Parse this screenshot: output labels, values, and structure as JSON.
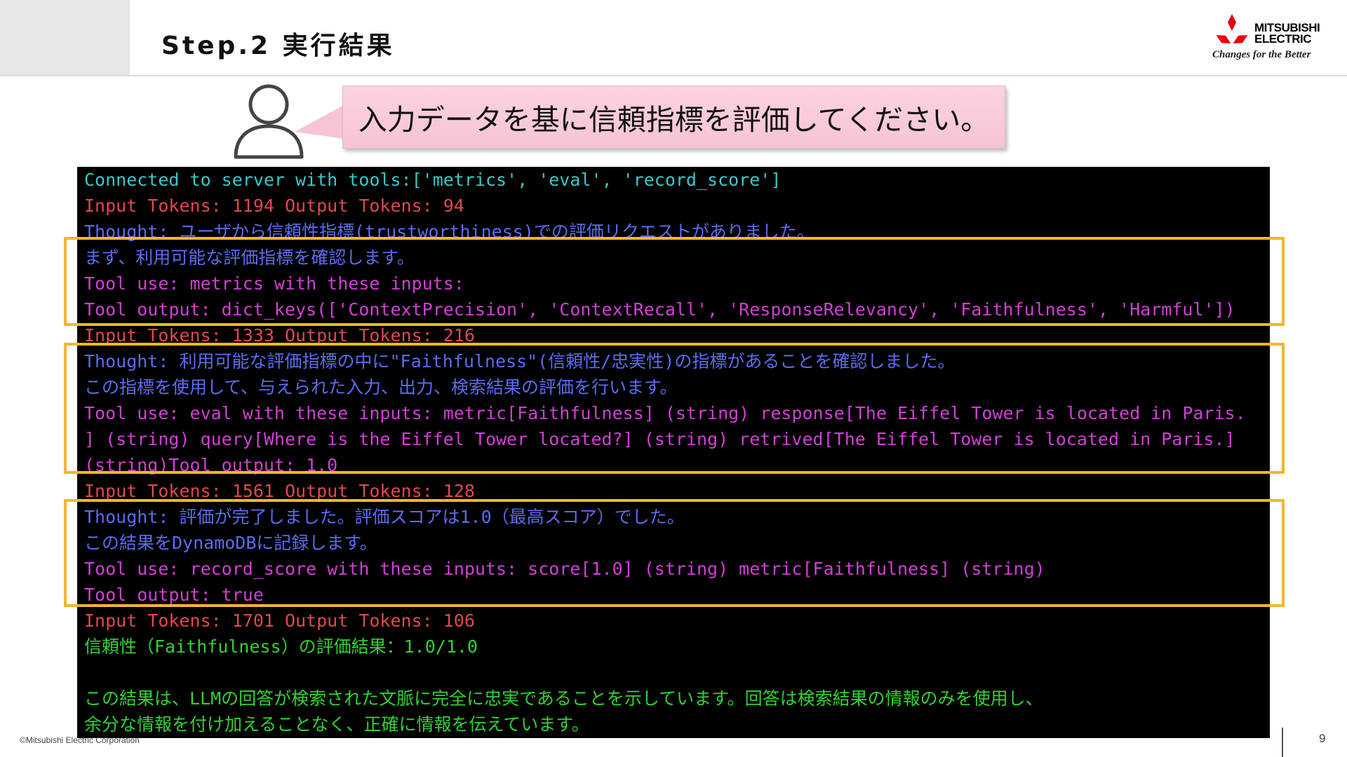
{
  "header": {
    "title": "Step.2 実行結果"
  },
  "logo": {
    "line1": "MITSUBISHI",
    "line2": "ELECTRIC",
    "tagline": "Changes for the Better"
  },
  "prompt": {
    "text": "入力データを基に信頼指標を評価してください。"
  },
  "terminal": {
    "lines": [
      {
        "text": "Connected to server with tools:['metrics', 'eval', 'record_score']",
        "color": "#3ac8c8"
      },
      {
        "text": "Input Tokens: 1194 Output Tokens: 94",
        "color": "#e0484e"
      },
      {
        "text": "Thought: ユーザから信頼性指標(trustworthiness)での評価リクエストがありました。",
        "color": "#5b6cf0"
      },
      {
        "text": "まず、利用可能な評価指標を確認します。",
        "color": "#5b6cf0"
      },
      {
        "text": "Tool use: metrics with these inputs:",
        "color": "#d23fd6"
      },
      {
        "text": "Tool output: dict_keys(['ContextPrecision', 'ContextRecall', 'ResponseRelevancy', 'Faithfulness', 'Harmful'])",
        "color": "#d23fd6"
      },
      {
        "text": "Input Tokens: 1333 Output Tokens: 216",
        "color": "#e0484e"
      },
      {
        "text": "Thought: 利用可能な評価指標の中に\"Faithfulness\"(信頼性/忠実性)の指標があることを確認しました。",
        "color": "#5b6cf0"
      },
      {
        "text": "この指標を使用して、与えられた入力、出力、検索結果の評価を行います。",
        "color": "#5b6cf0"
      },
      {
        "text": "Tool use: eval with these inputs: metric[Faithfulness] (string) response[The Eiffel Tower is located in Paris.",
        "color": "#d23fd6"
      },
      {
        "text": "] (string) query[Where is the Eiffel Tower located?] (string) retrived[The Eiffel Tower is located in Paris.]",
        "color": "#d23fd6"
      },
      {
        "text": "(string)Tool output: 1.0",
        "color": "#d23fd6"
      },
      {
        "text": "Input Tokens: 1561 Output Tokens: 128",
        "color": "#e0484e"
      },
      {
        "text": "Thought: 評価が完了しました。評価スコアは1.0（最高スコア）でした。",
        "color": "#5b6cf0"
      },
      {
        "text": "この結果をDynamoDBに記録します。",
        "color": "#5b6cf0"
      },
      {
        "text": "Tool use: record_score with these inputs: score[1.0] (string) metric[Faithfulness] (string)",
        "color": "#d23fd6"
      },
      {
        "text": "Tool output: true",
        "color": "#d23fd6"
      },
      {
        "text": "Input Tokens: 1701 Output Tokens: 106",
        "color": "#e0484e"
      },
      {
        "text": "信頼性（Faithfulness）の評価結果：1.0/1.0",
        "color": "#31d233"
      },
      {
        "text": "",
        "color": "#31d233"
      },
      {
        "text": "この結果は、LLMの回答が検索された文脈に完全に忠実であることを示しています。回答は検索結果の情報のみを使用し、",
        "color": "#31d233"
      },
      {
        "text": "余分な情報を付け加えることなく、正確に情報を伝えています。",
        "color": "#31d233"
      }
    ]
  },
  "footer": {
    "copyright": "©Mitsubishi Electric Corporation",
    "page_number": "9"
  }
}
